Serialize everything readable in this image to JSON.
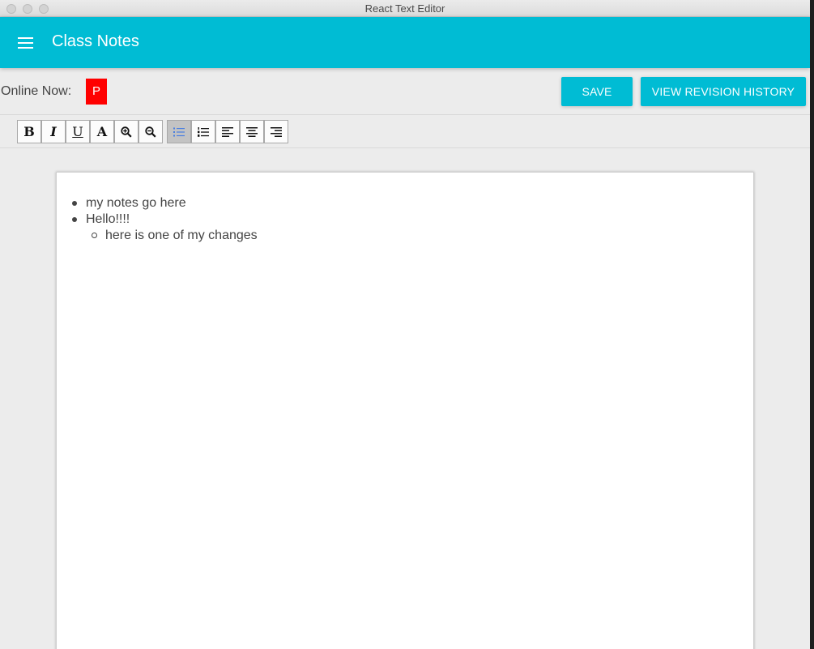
{
  "window": {
    "title": "React Text Editor"
  },
  "appbar": {
    "title": "Class Notes",
    "menu_icon": "hamburger-menu-icon"
  },
  "presence": {
    "label": "Online Now:",
    "users": [
      "P"
    ],
    "user_color": "#ff0000"
  },
  "actions": {
    "save_label": "SAVE",
    "history_label": "VIEW REVISION HISTORY"
  },
  "toolbar": {
    "bold": "B",
    "italic": "I",
    "underline": "U",
    "font": "A",
    "active_tool": "unordered-list"
  },
  "document": {
    "items": [
      "my notes go here",
      "Hello!!!!"
    ],
    "sub_items": [
      "here is one of my changes"
    ]
  },
  "colors": {
    "accent": "#00bcd4",
    "background": "#ececec"
  }
}
